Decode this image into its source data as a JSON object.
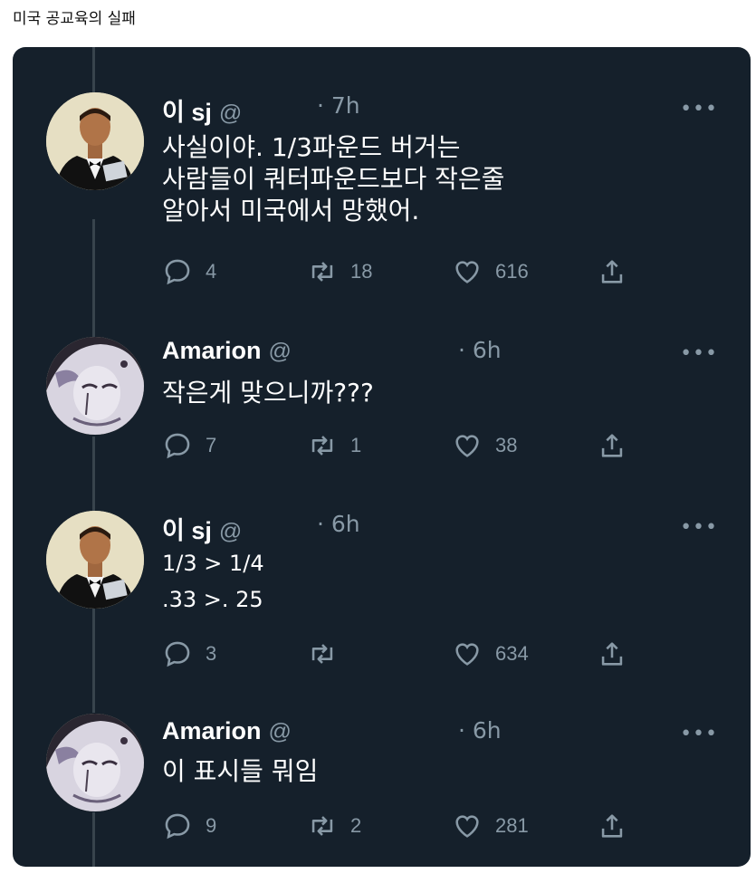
{
  "page": {
    "title": "미국 공교육의 실패"
  },
  "tweets": [
    {
      "name": "이 sj",
      "handle": "@",
      "time": "· 7h",
      "lines": [
        "사실이야. 1/3파운드 버거는",
        "사람들이 쿼터파운드보다 작은줄",
        "알아서 미국에서 망했어."
      ],
      "replies": "4",
      "retweets": "18",
      "likes": "616",
      "avatar": "man-in-tuxedo"
    },
    {
      "name": "Amarion",
      "handle": "@",
      "time": "· 6h",
      "lines": [
        "작은게 맞으니까???"
      ],
      "replies": "7",
      "retweets": "1",
      "likes": "38",
      "avatar": "anime-character"
    },
    {
      "name": "이 sj",
      "handle": "@",
      "time": "· 6h",
      "lines": [
        "1/3 > 1/4",
        ".33 >. 25"
      ],
      "replies": "3",
      "retweets": "",
      "likes": "634",
      "avatar": "man-in-tuxedo"
    },
    {
      "name": "Amarion",
      "handle": "@",
      "time": "· 6h",
      "lines": [
        "이 표시들 뭐임"
      ],
      "replies": "9",
      "retweets": "2",
      "likes": "281",
      "avatar": "anime-character"
    }
  ],
  "icons": {
    "more": "more-dots-icon",
    "reply": "reply-icon",
    "retweet": "retweet-icon",
    "like": "heart-icon",
    "share": "share-icon"
  },
  "colors": {
    "background": "#15202b",
    "text": "#ffffff",
    "muted": "#8899a6",
    "thread_line": "#38444d"
  }
}
